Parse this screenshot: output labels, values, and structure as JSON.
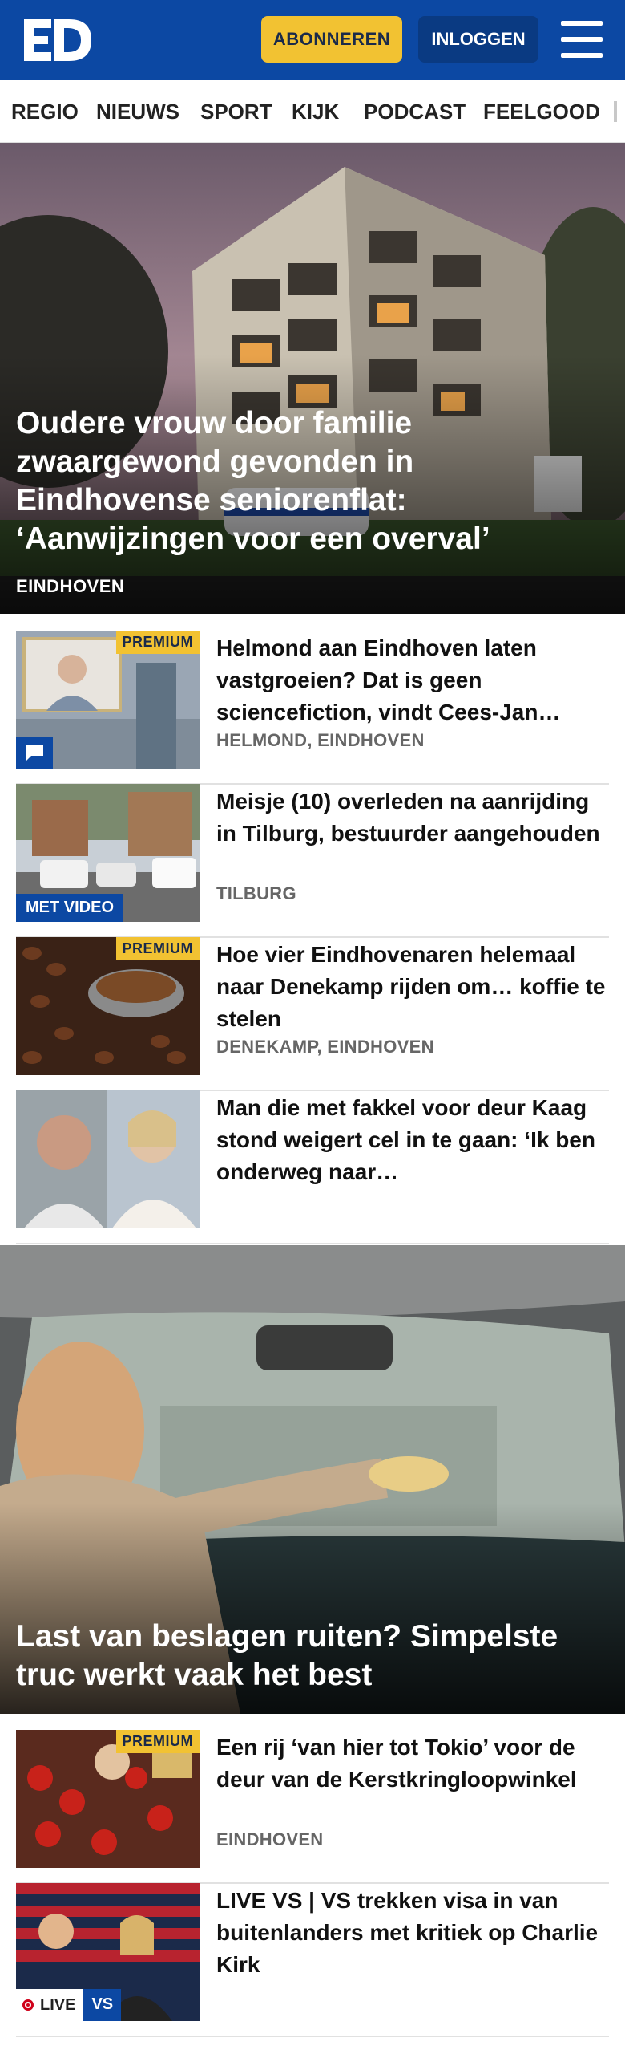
{
  "header": {
    "logo_text": "ED",
    "subscribe_label": "ABONNEREN",
    "login_label": "INLOGGEN",
    "menu_icon": "hamburger-icon",
    "brand_color": "#0c48a3",
    "accent_color": "#f2c232"
  },
  "nav": {
    "items": [
      "REGIO",
      "NIEUWS",
      "SPORT",
      "KIJK",
      "PODCAST",
      "FEELGOOD"
    ]
  },
  "hero": {
    "title": "Oudere vrouw door familie zwaargewond gevonden in Eindhovense seniorenflat: ‘Aanwijzingen voor een overval’",
    "tag": "EINDHOVEN"
  },
  "articles": [
    {
      "title": "Helmond aan Eindhoven laten vastgroeien? Dat is geen sciencefiction, vindt Cees-Jan…",
      "tag": "HELMOND, EINDHOVEN",
      "badge": "PREMIUM",
      "icon": "comment-icon"
    },
    {
      "title": "Meisje (10) overleden na aanrijding in Tilburg, bestuurder aangehouden",
      "tag": "TILBURG",
      "badge": "MET VIDEO"
    },
    {
      "title": "Hoe vier Eindhovenaren helemaal naar Denekamp rijden om… koffie te stelen",
      "tag": "DENEKAMP, EINDHOVEN",
      "badge": "PREMIUM"
    },
    {
      "title": "Man die met fakkel voor deur Kaag stond weigert cel in te gaan: ‘Ik ben onderweg naar…",
      "tag": ""
    }
  ],
  "hero2": {
    "title": "Last van beslagen ruiten? Simpelste truc werkt vaak het best"
  },
  "articles2": [
    {
      "title": "Een rij ‘van hier tot Tokio’ voor de deur van de Kerstkringloopwinkel",
      "tag": "EINDHOVEN",
      "badge": "PREMIUM"
    },
    {
      "title": "LIVE VS | VS trekken visa in van buitenlanders met kritiek op Charlie Kirk",
      "tag": "",
      "live_label": "LIVE",
      "vs_label": "VS"
    }
  ]
}
